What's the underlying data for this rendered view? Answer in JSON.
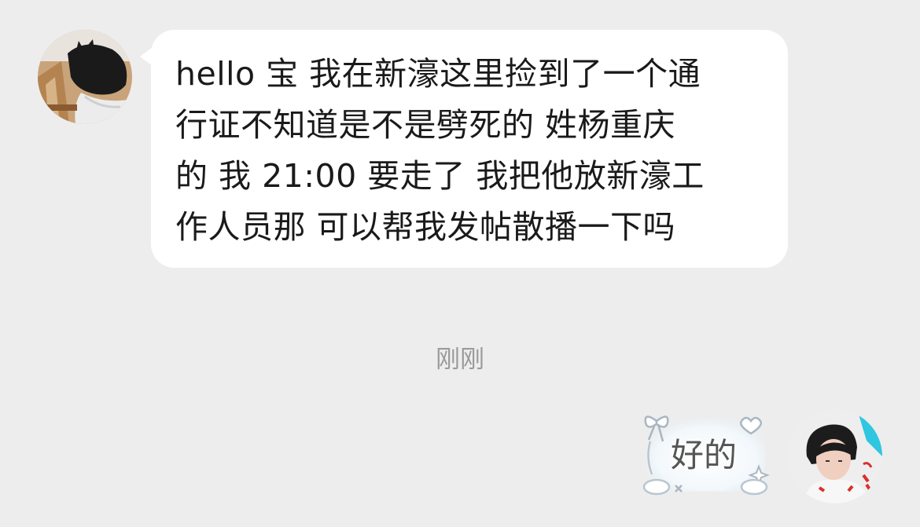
{
  "conversation": {
    "incoming": {
      "lines": [
        "hello 宝 我在新濠这里捡到了一个通",
        "行证不知道是不是劈死的 姓杨重庆",
        "的 我 21:00 要走了 我把他放新濠工",
        "作人员那 可以帮我发帖散播一下吗"
      ]
    },
    "timestamp": "刚刚",
    "outgoing": {
      "text": "好的"
    }
  },
  "colors": {
    "background": "#ededed",
    "incoming_bubble": "#ffffff",
    "text": "#1a1a1a",
    "timestamp": "#9a9a9a"
  },
  "icons": {
    "left_avatar": "black-cat-avatar",
    "right_avatar": "user-portrait-avatar",
    "sticker": "ribbon-bow-sticker-frame"
  }
}
